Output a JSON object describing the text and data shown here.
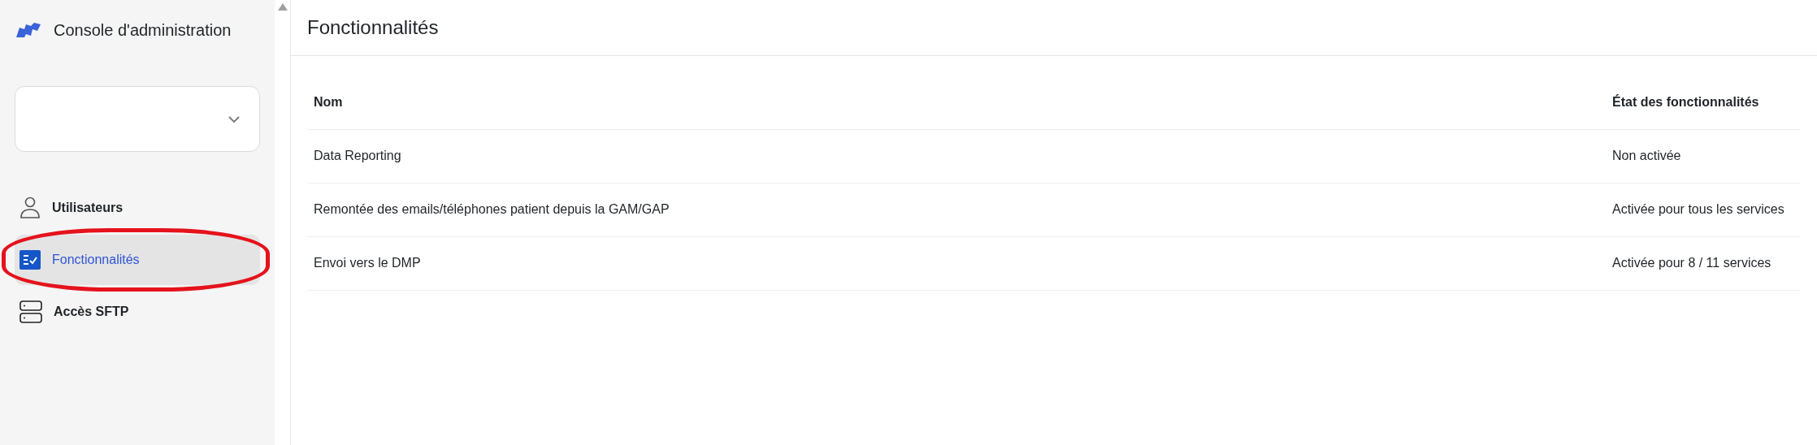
{
  "sidebar": {
    "title": "Console d'administration",
    "items": [
      {
        "kind": "user",
        "label": "Utilisateurs",
        "selected": false
      },
      {
        "kind": "features",
        "label": "Fonctionnalités",
        "selected": true
      },
      {
        "kind": "server",
        "label": "Accès SFTP",
        "selected": false
      }
    ]
  },
  "page": {
    "title": "Fonctionnalités"
  },
  "table": {
    "columns": [
      "Nom",
      "État des fonctionnalités"
    ],
    "rows": [
      [
        "Data Reporting",
        "Non activée"
      ],
      [
        "Remontée des emails/téléphones patient depuis la GAM/GAP",
        "Activée pour tous les services"
      ],
      [
        "Envoi vers le DMP",
        "Activée pour 8 / 11 services"
      ]
    ]
  }
}
